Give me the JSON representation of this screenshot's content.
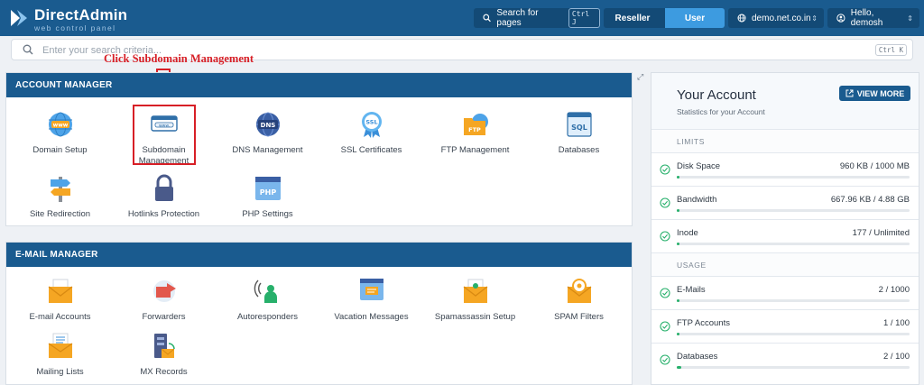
{
  "brand": {
    "title": "DirectAdmin",
    "subtitle": "web control panel"
  },
  "topbar": {
    "search_pages_label": "Search for pages",
    "search_pages_shortcut": "Ctrl J",
    "role_reseller": "Reseller",
    "role_user": "User",
    "domain": "demo.net.co.in",
    "greeting": "Hello, demosh"
  },
  "search": {
    "placeholder": "Enter your search criteria...",
    "shortcut": "Ctrl K"
  },
  "annotation": {
    "text": "Click Subdomain Management",
    "color": "#d71f26"
  },
  "account_manager": {
    "title": "ACCOUNT MANAGER",
    "items": [
      {
        "label": "Domain Setup",
        "icon": "globe-www-icon"
      },
      {
        "label": "Subdomain Management",
        "icon": "browser-www-icon"
      },
      {
        "label": "DNS Management",
        "icon": "dns-globe-icon"
      },
      {
        "label": "SSL Certificates",
        "icon": "ssl-badge-icon"
      },
      {
        "label": "FTP Management",
        "icon": "ftp-folder-icon"
      },
      {
        "label": "Databases",
        "icon": "sql-database-icon"
      },
      {
        "label": "Site Redirection",
        "icon": "signpost-icon"
      },
      {
        "label": "Hotlinks Protection",
        "icon": "padlock-icon"
      },
      {
        "label": "PHP Settings",
        "icon": "php-window-icon"
      }
    ]
  },
  "email_manager": {
    "title": "E-MAIL MANAGER",
    "items": [
      {
        "label": "E-mail Accounts",
        "icon": "envelope-icon"
      },
      {
        "label": "Forwarders",
        "icon": "forward-mail-icon"
      },
      {
        "label": "Autoresponders",
        "icon": "auto-reply-person-icon"
      },
      {
        "label": "Vacation Messages",
        "icon": "vacation-window-icon"
      },
      {
        "label": "Spamassassin Setup",
        "icon": "spam-envelope-icon"
      },
      {
        "label": "SPAM Filters",
        "icon": "filter-envelope-icon"
      },
      {
        "label": "Mailing Lists",
        "icon": "mailing-list-icon"
      },
      {
        "label": "MX Records",
        "icon": "mx-server-icon"
      }
    ]
  },
  "your_account": {
    "title": "Your Account",
    "subtitle": "Statistics for your Account",
    "view_more": "VIEW MORE",
    "limits_label": "LIMITS",
    "usage_label": "USAGE",
    "limits": [
      {
        "name": "Disk Space",
        "value": "960 KB / 1000 MB",
        "fraction": 0.001
      },
      {
        "name": "Bandwidth",
        "value": "667.96 KB / 4.88 GB",
        "fraction": 0.0001
      },
      {
        "name": "Inode",
        "value": "177 / Unlimited",
        "fraction": 0.0
      }
    ],
    "usage": [
      {
        "name": "E-Mails",
        "value": "2 / 1000",
        "fraction": 0.002
      },
      {
        "name": "FTP Accounts",
        "value": "1 / 100",
        "fraction": 0.01
      },
      {
        "name": "Databases",
        "value": "2 / 100",
        "fraction": 0.02
      }
    ]
  },
  "colors": {
    "brand": "#1a5b8f",
    "accent": "#3d9be0",
    "ok": "#27b06b"
  }
}
